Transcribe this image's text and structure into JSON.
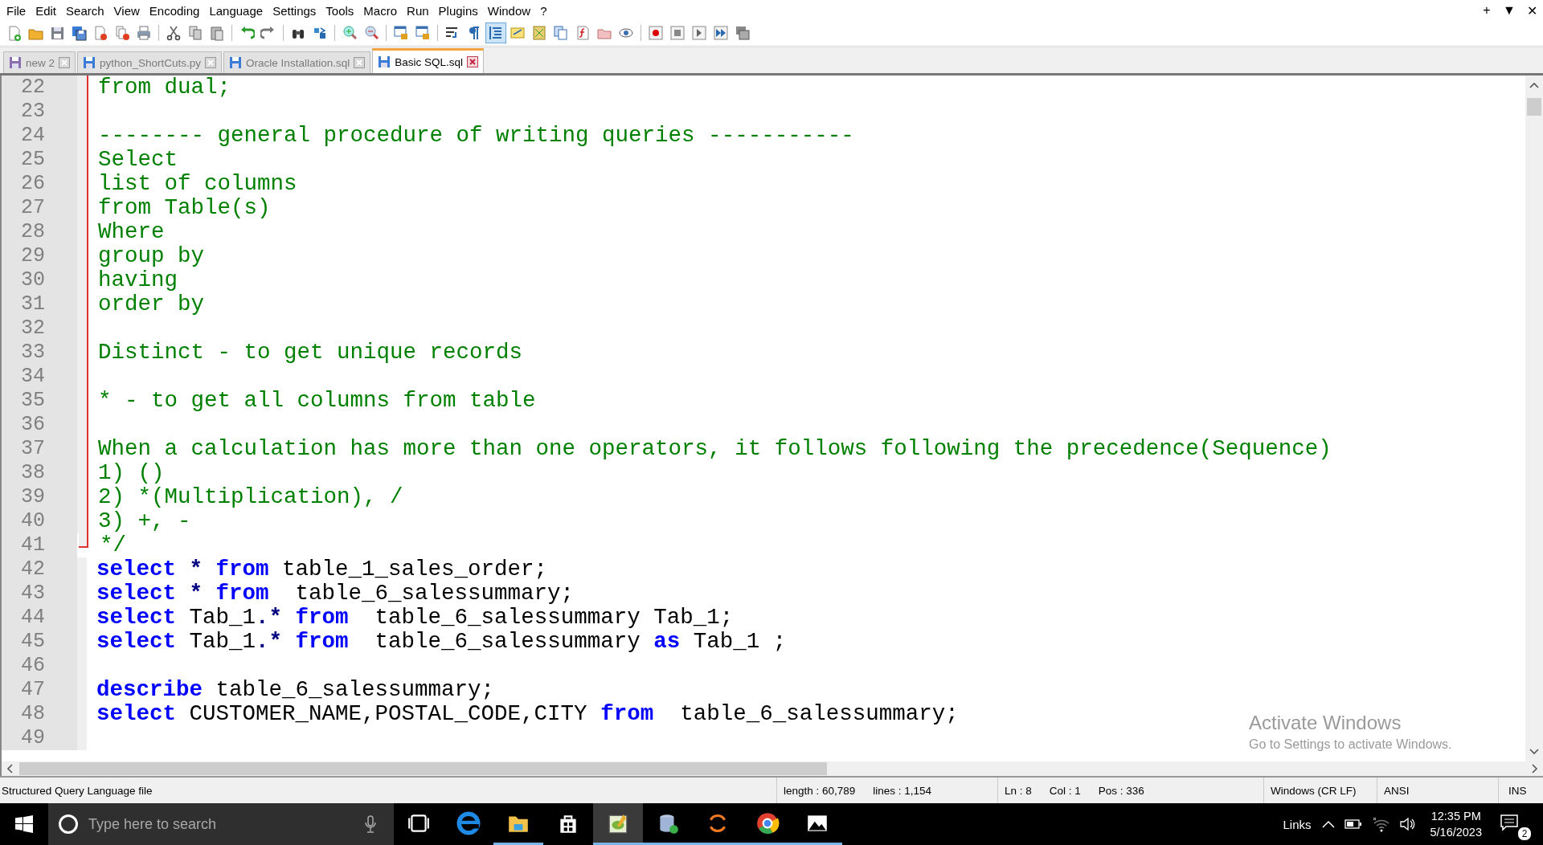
{
  "menu": {
    "items": [
      "File",
      "Edit",
      "Search",
      "View",
      "Encoding",
      "Language",
      "Settings",
      "Tools",
      "Macro",
      "Run",
      "Plugins",
      "Window",
      "?"
    ],
    "window_controls": [
      "+",
      "▼",
      "✕"
    ]
  },
  "toolbar": [
    {
      "kind": "new",
      "pressed": false
    },
    {
      "kind": "open",
      "pressed": false
    },
    {
      "kind": "save",
      "pressed": false
    },
    {
      "kind": "save-all",
      "pressed": false
    },
    {
      "kind": "close",
      "pressed": false
    },
    {
      "kind": "close-all",
      "pressed": false
    },
    {
      "kind": "print",
      "pressed": false
    },
    {
      "kind": "separator"
    },
    {
      "kind": "cut",
      "pressed": false
    },
    {
      "kind": "copy",
      "pressed": false
    },
    {
      "kind": "paste",
      "pressed": false
    },
    {
      "kind": "separator"
    },
    {
      "kind": "undo",
      "pressed": false
    },
    {
      "kind": "redo",
      "pressed": false
    },
    {
      "kind": "separator"
    },
    {
      "kind": "find",
      "pressed": false
    },
    {
      "kind": "replace",
      "pressed": false
    },
    {
      "kind": "separator"
    },
    {
      "kind": "zoom-in",
      "pressed": false
    },
    {
      "kind": "zoom-out",
      "pressed": false
    },
    {
      "kind": "separator"
    },
    {
      "kind": "sync",
      "pressed": false
    },
    {
      "kind": "sync",
      "pressed": false
    },
    {
      "kind": "separator"
    },
    {
      "kind": "wrap",
      "pressed": false
    },
    {
      "kind": "pilcrow",
      "pressed": false
    },
    {
      "kind": "indent",
      "pressed": true
    },
    {
      "kind": "note",
      "pressed": false
    },
    {
      "kind": "map",
      "pressed": false
    },
    {
      "kind": "pages",
      "pressed": false
    },
    {
      "kind": "function",
      "pressed": false
    },
    {
      "kind": "folder",
      "pressed": false
    },
    {
      "kind": "eye",
      "pressed": false
    },
    {
      "kind": "separator"
    },
    {
      "kind": "record",
      "pressed": false
    },
    {
      "kind": "stop",
      "pressed": false
    },
    {
      "kind": "play",
      "pressed": false
    },
    {
      "kind": "play-multi",
      "pressed": false
    },
    {
      "kind": "save-macro",
      "pressed": false
    }
  ],
  "tabs": [
    {
      "label": "new 2",
      "selected": false,
      "unsaved": true
    },
    {
      "label": "python_ShortCuts.py",
      "selected": false,
      "unsaved": false
    },
    {
      "label": "Oracle Installation.sql",
      "selected": false,
      "unsaved": false
    },
    {
      "label": "Basic SQL.sql",
      "selected": true,
      "unsaved": false
    }
  ],
  "editor": {
    "lines": [
      {
        "number": "22",
        "in_fold": true,
        "fold_end": false,
        "tokens": [
          {
            "kind": "comment",
            "text": "from dual;"
          }
        ]
      },
      {
        "number": "23",
        "in_fold": true,
        "fold_end": false
      },
      {
        "number": "24",
        "in_fold": true,
        "fold_end": false,
        "tokens": [
          {
            "kind": "comment",
            "text": "-------- general procedure of writing queries -----------"
          }
        ]
      },
      {
        "number": "25",
        "in_fold": true,
        "fold_end": false,
        "tokens": [
          {
            "kind": "comment",
            "text": "Select"
          }
        ]
      },
      {
        "number": "26",
        "in_fold": true,
        "fold_end": false,
        "tokens": [
          {
            "kind": "comment",
            "text": "list of columns"
          }
        ]
      },
      {
        "number": "27",
        "in_fold": true,
        "fold_end": false,
        "tokens": [
          {
            "kind": "comment",
            "text": "from Table(s)"
          }
        ]
      },
      {
        "number": "28",
        "in_fold": true,
        "fold_end": false,
        "tokens": [
          {
            "kind": "comment",
            "text": "Where"
          }
        ]
      },
      {
        "number": "29",
        "in_fold": true,
        "fold_end": false,
        "tokens": [
          {
            "kind": "comment",
            "text": "group by"
          }
        ]
      },
      {
        "number": "30",
        "in_fold": true,
        "fold_end": false,
        "tokens": [
          {
            "kind": "comment",
            "text": "having"
          }
        ]
      },
      {
        "number": "31",
        "in_fold": true,
        "fold_end": false,
        "tokens": [
          {
            "kind": "comment",
            "text": "order by"
          }
        ]
      },
      {
        "number": "32",
        "in_fold": true,
        "fold_end": false
      },
      {
        "number": "33",
        "in_fold": true,
        "fold_end": false,
        "tokens": [
          {
            "kind": "comment",
            "text": "Distinct - to get unique records"
          }
        ]
      },
      {
        "number": "34",
        "in_fold": true,
        "fold_end": false
      },
      {
        "number": "35",
        "in_fold": true,
        "fold_end": false,
        "tokens": [
          {
            "kind": "comment",
            "text": "* - to get all columns from table"
          }
        ]
      },
      {
        "number": "36",
        "in_fold": true,
        "fold_end": false
      },
      {
        "number": "37",
        "in_fold": true,
        "fold_end": false,
        "tokens": [
          {
            "kind": "comment",
            "text": "When a calculation has more than one operators, it follows following the precedence(Sequence)"
          }
        ]
      },
      {
        "number": "38",
        "in_fold": true,
        "fold_end": false,
        "tokens": [
          {
            "kind": "comment",
            "text": "1) ()"
          }
        ]
      },
      {
        "number": "39",
        "in_fold": true,
        "fold_end": false,
        "tokens": [
          {
            "kind": "comment",
            "text": "2) *(Multiplication), /"
          }
        ]
      },
      {
        "number": "40",
        "in_fold": true,
        "fold_end": false,
        "tokens": [
          {
            "kind": "comment",
            "text": "3) +, -"
          }
        ]
      },
      {
        "number": "41",
        "in_fold": true,
        "fold_end": true,
        "tokens": [
          {
            "kind": "comment",
            "text": "*/"
          }
        ]
      },
      {
        "number": "42",
        "in_fold": false,
        "fold_end": false,
        "tokens": [
          {
            "kind": "keyword",
            "text": "select"
          },
          {
            "kind": "operator",
            "text": " * "
          },
          {
            "kind": "keyword",
            "text": "from"
          },
          {
            "kind": "plain",
            "text": " table_1_sales_order;"
          }
        ]
      },
      {
        "number": "43",
        "in_fold": false,
        "fold_end": false,
        "tokens": [
          {
            "kind": "keyword",
            "text": "select"
          },
          {
            "kind": "operator",
            "text": " * "
          },
          {
            "kind": "keyword",
            "text": "from"
          },
          {
            "kind": "plain",
            "text": "  table_6_salessummary;"
          }
        ]
      },
      {
        "number": "44",
        "in_fold": false,
        "fold_end": false,
        "tokens": [
          {
            "kind": "keyword",
            "text": "select"
          },
          {
            "kind": "plain",
            "text": " Tab_1"
          },
          {
            "kind": "operator",
            "text": ".* "
          },
          {
            "kind": "keyword",
            "text": "from"
          },
          {
            "kind": "plain",
            "text": "  table_6_salessummary Tab_1;"
          }
        ]
      },
      {
        "number": "45",
        "in_fold": false,
        "fold_end": false,
        "tokens": [
          {
            "kind": "keyword",
            "text": "select"
          },
          {
            "kind": "plain",
            "text": " Tab_1"
          },
          {
            "kind": "operator",
            "text": ".* "
          },
          {
            "kind": "keyword",
            "text": "from"
          },
          {
            "kind": "plain",
            "text": "  table_6_salessummary "
          },
          {
            "kind": "keyword",
            "text": "as"
          },
          {
            "kind": "plain",
            "text": " Tab_1 ;"
          }
        ]
      },
      {
        "number": "46",
        "in_fold": false,
        "fold_end": false
      },
      {
        "number": "47",
        "in_fold": false,
        "fold_end": false,
        "tokens": [
          {
            "kind": "keyword",
            "text": "describe"
          },
          {
            "kind": "plain",
            "text": " table_6_salessummary;"
          }
        ]
      },
      {
        "number": "48",
        "in_fold": false,
        "fold_end": false,
        "tokens": [
          {
            "kind": "keyword",
            "text": "select"
          },
          {
            "kind": "plain",
            "text": " CUSTOMER_NAME,POSTAL_CODE,CITY "
          },
          {
            "kind": "keyword",
            "text": "from"
          },
          {
            "kind": "plain",
            "text": "  table_6_salessummary;"
          }
        ]
      },
      {
        "number": "49",
        "in_fold": false,
        "fold_end": false
      }
    ]
  },
  "activation_notice": {
    "title": "Activate Windows",
    "text": "Go to Settings to activate Windows."
  },
  "status_bar": [
    [
      "Structured Query Language file"
    ],
    [
      "length : 60,789",
      "lines : 1,154"
    ],
    [
      "Ln : 8",
      "Col : 1",
      "Pos : 336"
    ],
    [
      "Windows (CR LF)"
    ],
    [
      "ANSI"
    ],
    [
      "INS"
    ]
  ],
  "taskbar": {
    "search": {
      "placeholder": "Type here to search"
    },
    "apps": [
      {
        "kind": "task-view",
        "running": false,
        "active": false
      },
      {
        "kind": "edge",
        "running": false,
        "active": false
      },
      {
        "kind": "explorer",
        "running": true,
        "active": false
      },
      {
        "kind": "store",
        "running": false,
        "active": false
      },
      {
        "kind": "notepad",
        "running": true,
        "active": true
      },
      {
        "kind": "database",
        "running": true,
        "active": false
      },
      {
        "kind": "ring",
        "running": true,
        "active": false
      },
      {
        "kind": "chrome",
        "running": true,
        "active": false
      },
      {
        "kind": "photos",
        "running": true,
        "active": false
      }
    ],
    "links": "Links",
    "time": "12:35 PM",
    "date": "5/16/2023",
    "notifications": "2"
  }
}
